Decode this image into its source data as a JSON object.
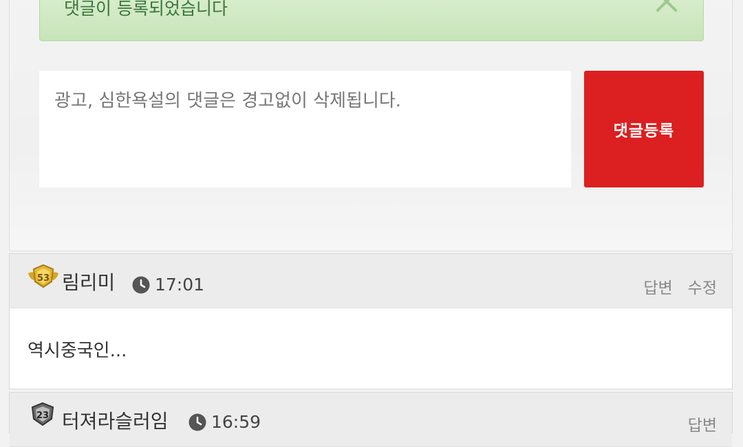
{
  "alert": {
    "message": "댓글이 등록되었습니다",
    "close_icon": "close-icon"
  },
  "comment_form": {
    "placeholder": "광고, 심한욕설의 댓글은 경고없이 삭제됩니다.",
    "submit_label": "댓글등록"
  },
  "comments": [
    {
      "level_badge": "53",
      "nickname": "림리미",
      "time": "17:01",
      "actions": [
        "답변",
        "수정"
      ],
      "body": "역시중국인..."
    },
    {
      "level_badge": "23",
      "nickname": "터져라슬러임",
      "time": "16:59",
      "actions": [
        "답변"
      ]
    }
  ],
  "colors": {
    "accent_red": "#dc1f20",
    "alert_green": "#3c763d",
    "alert_bg": "#d4ebc8"
  }
}
